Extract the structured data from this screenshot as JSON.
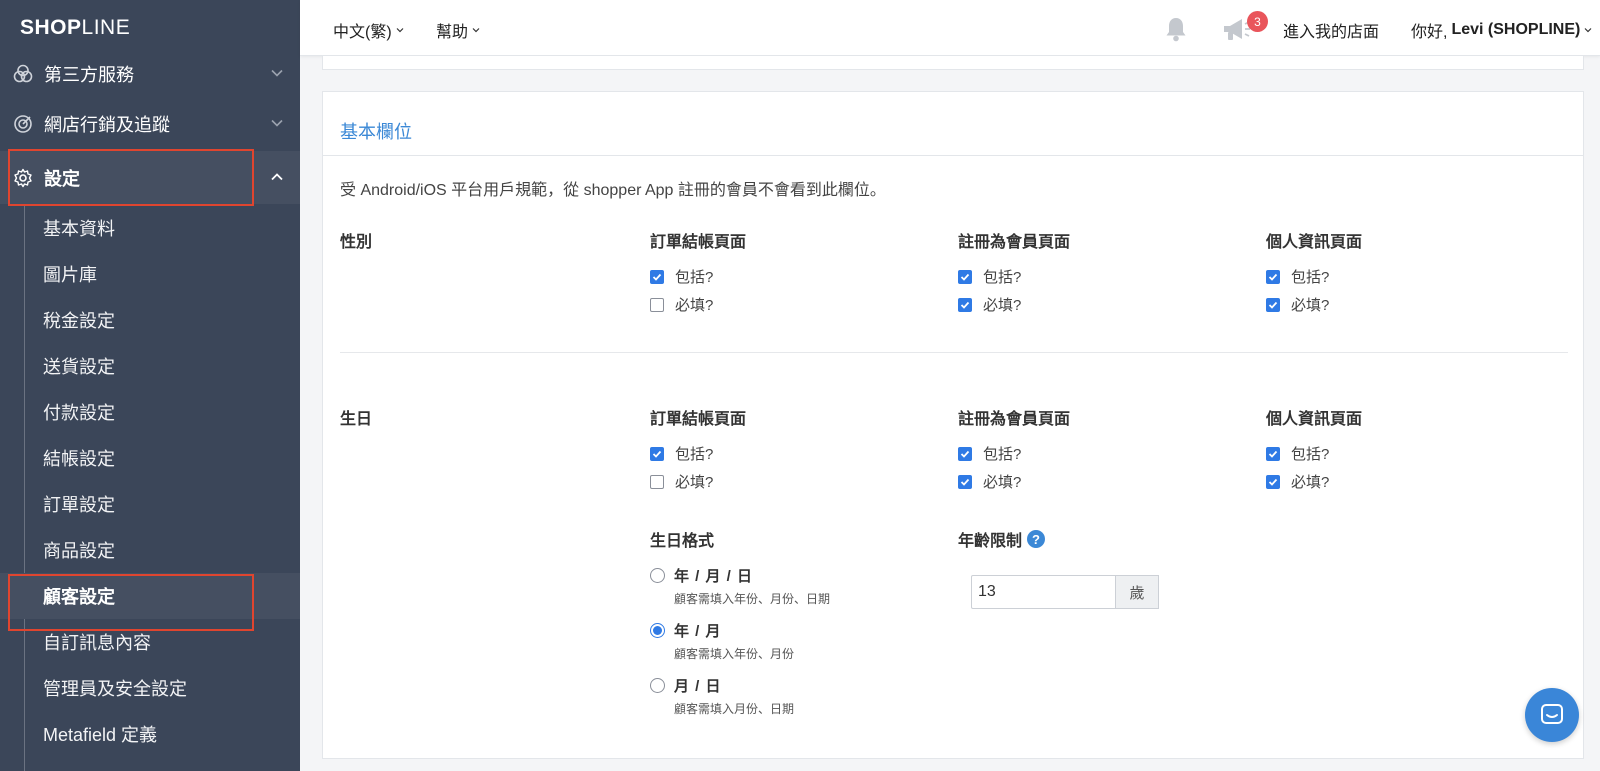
{
  "sidebar": {
    "logo": {
      "bold": "SHOP",
      "rest": "LINE"
    },
    "top_items": [
      {
        "label": "第三方服務",
        "icon": "integrations-icon"
      },
      {
        "label": "網店行銷及追蹤",
        "icon": "target-icon"
      },
      {
        "label": "設定",
        "icon": "gear-icon"
      }
    ],
    "sub_items": [
      "基本資料",
      "圖片庫",
      "稅金設定",
      "送貨設定",
      "付款設定",
      "結帳設定",
      "訂單設定",
      "商品設定",
      "顧客設定",
      "自訂訊息內容",
      "管理員及安全設定",
      "Metafield 定義"
    ],
    "active_sub": "顧客設定"
  },
  "header": {
    "language": "中文(繁)",
    "help": "幫助",
    "notification_count": "3",
    "store_link": "進入我的店面",
    "greeting": "你好,",
    "user": "Levi (SHOPLINE)"
  },
  "card": {
    "title": "基本欄位",
    "notice": "受 Android/iOS 平台用戶規範，從 shopper App 註冊的會員不會看到此欄位。",
    "columns": [
      "訂單結帳頁面",
      "註冊為會員頁面",
      "個人資訊頁面"
    ],
    "include_label": "包括?",
    "required_label": "必填?",
    "fields": [
      {
        "label": "性別",
        "include": [
          true,
          true,
          true
        ],
        "required": [
          false,
          true,
          true
        ]
      },
      {
        "label": "生日",
        "include": [
          true,
          true,
          true
        ],
        "required": [
          false,
          true,
          true
        ]
      }
    ],
    "birthday_format": {
      "label": "生日格式",
      "options": [
        {
          "title": "年 / 月 / 日",
          "desc": "顧客需填入年份、月份、日期",
          "selected": false
        },
        {
          "title": "年 / 月",
          "desc": "顧客需填入年份、月份",
          "selected": true
        },
        {
          "title": "月 / 日",
          "desc": "顧客需填入月份、日期",
          "selected": false
        }
      ]
    },
    "age_limit": {
      "label": "年齡限制",
      "help": "?",
      "value": "13",
      "unit": "歲"
    }
  },
  "colors": {
    "sidebar_bg": "#3b4659",
    "accent": "#3b88d6",
    "highlight": "#e0452f",
    "badge": "#e9555b"
  }
}
